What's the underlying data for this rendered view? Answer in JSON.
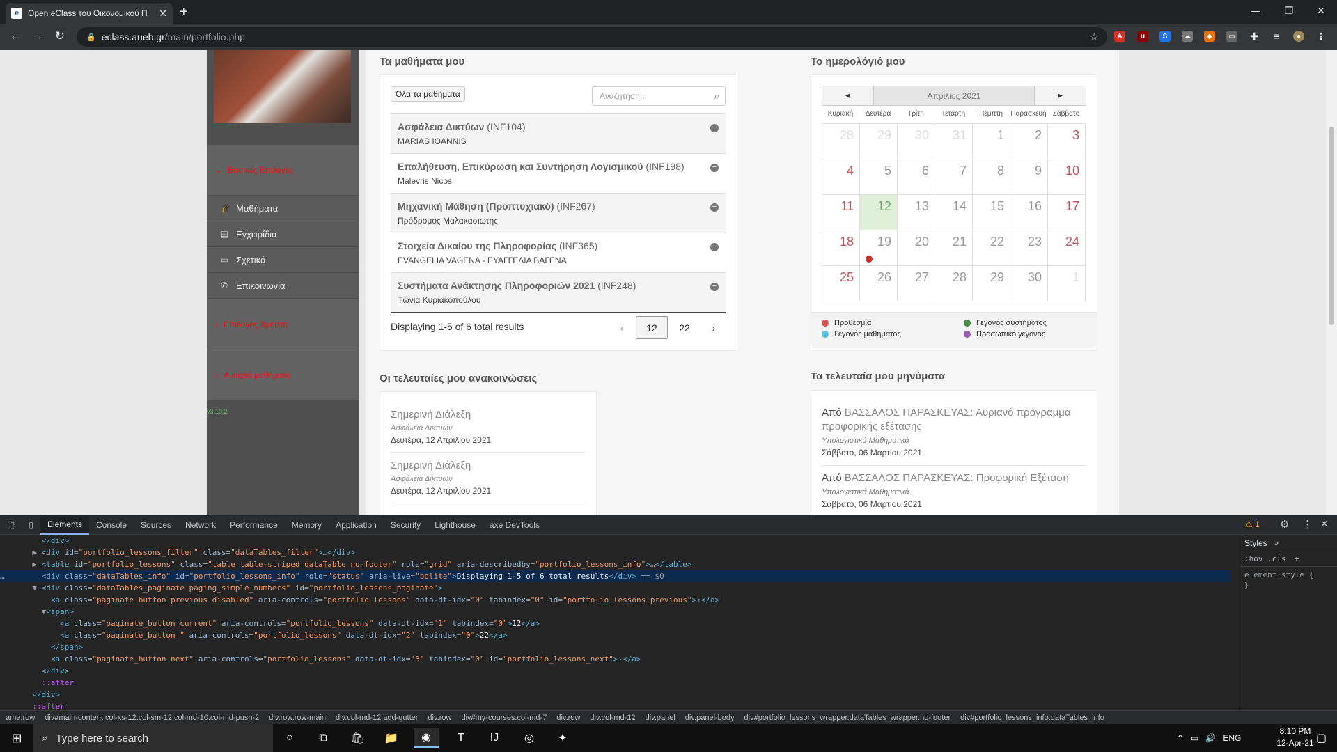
{
  "browser": {
    "tab_title": "Open eClass του Οικονομικού Π",
    "url_host": "eclass.aueb.gr",
    "url_path": "/main/portfolio.php"
  },
  "sidebar": {
    "section1": "Βασικές Επιλογές",
    "items": [
      {
        "label": "Μαθήματα",
        "icon": "graduation-cap-icon"
      },
      {
        "label": "Εγχειρίδια",
        "icon": "document-icon"
      },
      {
        "label": "Σχετικά",
        "icon": "card-icon"
      },
      {
        "label": "Επικοινωνία",
        "icon": "phone-icon"
      }
    ],
    "section2": "Επιλογές Χρήστη",
    "section3": "Ανοιχτά μαθήματα",
    "version": "v3.10.2"
  },
  "courses": {
    "title": "Τα μαθήματα μου",
    "all_button": "Όλα τα μαθήματα",
    "search_placeholder": "Αναζήτηση...",
    "rows": [
      {
        "name": "Ασφάλεια Δικτύων",
        "code": "(INF104)",
        "prof": "MARIAS IOANNIS"
      },
      {
        "name": "Επαλήθευση, Επικύρωση και Συντήρηση Λογισμικού",
        "code": "(INF198)",
        "prof": "Malevris Nicos"
      },
      {
        "name": "Μηχανική Μάθηση (Προπτυχιακό)",
        "code": "(INF267)",
        "prof": "Πρόδρομος Μαλακασιώτης"
      },
      {
        "name": "Στοιχεία Δικαίου της Πληροφορίας",
        "code": "(INF365)",
        "prof": "EVANGELIA VAGENA - ΕΥΑΓΓΕΛΙΑ ΒΑΓΕΝΑ"
      },
      {
        "name": "Συστήματα Ανάκτησης Πληροφοριών 2021",
        "code": "(INF248)",
        "prof": "Τώνια Κυριακοπούλου"
      }
    ],
    "info": "Displaying 1-5 of 6 total results",
    "pagination": {
      "prev": "‹",
      "current": "12",
      "page2": "22",
      "next": "›"
    }
  },
  "calendar": {
    "title": "Το ημερολόγιό μου",
    "month": "Απρίλιος 2021",
    "prev": "◀",
    "next": "▶",
    "weekdays": [
      "Κυριακή",
      "Δευτέρα",
      "Τρίτη",
      "Τετάρτη",
      "Πέμπτη",
      "Παρασκευή",
      "Σάββατο"
    ],
    "weeks": [
      [
        "28",
        "29",
        "30",
        "31",
        "1",
        "2",
        "3"
      ],
      [
        "4",
        "5",
        "6",
        "7",
        "8",
        "9",
        "10"
      ],
      [
        "11",
        "12",
        "13",
        "14",
        "15",
        "16",
        "17"
      ],
      [
        "18",
        "19",
        "20",
        "21",
        "22",
        "23",
        "24"
      ],
      [
        "25",
        "26",
        "27",
        "28",
        "29",
        "30",
        "1"
      ]
    ],
    "legend": [
      {
        "label": "Προθεσμία",
        "color": "#d9534f"
      },
      {
        "label": "Γεγονός συστήματος",
        "color": "#3c8a3c"
      },
      {
        "label": "Γεγονός μαθήματος",
        "color": "#5bc0de"
      },
      {
        "label": "Προσωπικό γεγονός",
        "color": "#9b59b6"
      }
    ]
  },
  "announcements": {
    "title": "Οι τελευταίες μου ανακοινώσεις",
    "items": [
      {
        "title": "Σημερινή Διάλεξη",
        "course": "Ασφάλεια Δικτύων",
        "date": "Δευτέρα, 12 Απριλίου 2021"
      },
      {
        "title": "Σημερινή Διάλεξη",
        "course": "Ασφάλεια Δικτύων",
        "date": "Δευτέρα, 12 Απριλίου 2021"
      }
    ]
  },
  "messages": {
    "title": "Τα τελευταία μου μηνύματα",
    "items": [
      {
        "from": "Από",
        "subject": "ΒΑΣΣΑΛΟΣ ΠΑΡΑΣΚΕΥΑΣ: Αυριανό πρόγραμμα προφορικής εξέτασης",
        "course": "Υπολογιστικά Μαθηματικά",
        "date": "Σάββατο, 06 Μαρτίου 2021"
      },
      {
        "from": "Από",
        "subject": "ΒΑΣΣΑΛΟΣ ΠΑΡΑΣΚΕΥΑΣ: Προφορική Εξέταση",
        "course": "Υπολογιστικά Μαθηματικά",
        "date": "Σάββατο, 06 Μαρτίου 2021"
      }
    ]
  },
  "devtools": {
    "tabs": [
      "Elements",
      "Console",
      "Sources",
      "Network",
      "Performance",
      "Memory",
      "Application",
      "Security",
      "Lighthouse",
      "axe DevTools"
    ],
    "warnings": "1",
    "styles_tab": "Styles",
    "styles_filter": ":hov  .cls",
    "breadcrumbs": [
      "ame.row",
      "div#main-content.col-xs-12.col-sm-12.col-md-10.col-md-push-2",
      "div.row.row-main",
      "div.col-md-12.add-gutter",
      "div.row",
      "div#my-courses.col-md-7",
      "div.row",
      "div.col-md-12",
      "div.panel",
      "div.panel-body",
      "div#portfolio_lessons_wrapper.dataTables_wrapper.no-footer",
      "div#portfolio_lessons_info.dataTables_info"
    ]
  },
  "taskbar": {
    "search_placeholder": "Type here to search",
    "lang": "ENG",
    "time": "8:10 PM",
    "date": "12-Apr-21"
  }
}
